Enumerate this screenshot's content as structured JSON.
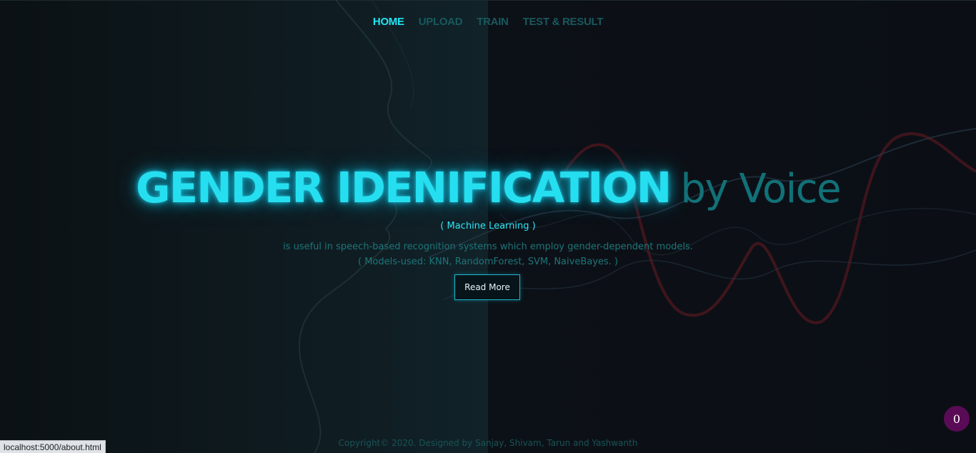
{
  "nav": {
    "items": [
      {
        "label": "HOME",
        "active": true
      },
      {
        "label": "UPLOAD",
        "active": false
      },
      {
        "label": "TRAIN",
        "active": false
      },
      {
        "label": "TEST & RESULT",
        "active": false
      }
    ]
  },
  "hero": {
    "title_main": "GENDER IDENIFICATION",
    "title_sub": "by Voice",
    "tag": "( Machine Learning )",
    "description_line1": "is useful in speech-based recognition systems which employ gender-dependent models.",
    "description_line2": "( Models-used: KNN, RandomForest, SVM, NaiveBayes. )",
    "button_label": "Read More"
  },
  "footer": {
    "copyright": "Copyright© 2020. Designed by Sanjay, Shivam, Tarun and Yashwanth"
  },
  "badge": {
    "count": "0"
  },
  "status_bar": {
    "url": "localhost:5000/about.html"
  },
  "colors": {
    "accent": "#22e4f2",
    "nav_inactive": "#18595d",
    "badge_bg": "#5a0b55"
  },
  "icons": {
    "background_art": "face-profile-and-sound-waves"
  }
}
